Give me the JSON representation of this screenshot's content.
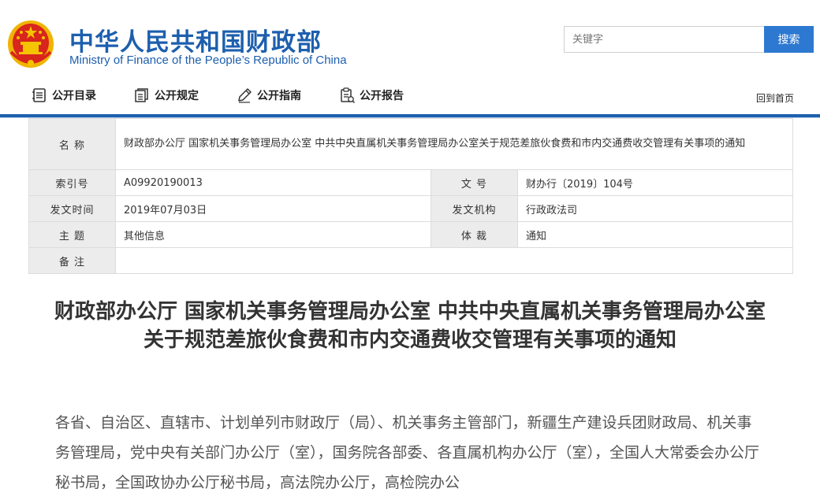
{
  "header": {
    "title_cn": "中华人民共和国财政部",
    "title_en": "Ministry of Finance of the People’s Republic of China",
    "search_placeholder": "关键字",
    "search_button": "搜索"
  },
  "nav": {
    "items": [
      {
        "label": "公开目录",
        "icon": "catalog-icon"
      },
      {
        "label": "公开规定",
        "icon": "documents-icon"
      },
      {
        "label": "公开指南",
        "icon": "pencil-icon"
      },
      {
        "label": "公开报告",
        "icon": "clipboard-icon"
      }
    ],
    "home": "回到首页"
  },
  "meta": {
    "name_label": "名 称",
    "name_value": "财政部办公厅 国家机关事务管理局办公室 中共中央直属机关事务管理局办公室关于规范差旅伙食费和市内交通费收交管理有关事项的通知",
    "index_label": "索引号",
    "index_value": "A09920190013",
    "docno_label": "文 号",
    "docno_value": "财办行〔2019〕104号",
    "date_label": "发文时间",
    "date_value": "2019年07月03日",
    "org_label": "发文机构",
    "org_value": "行政政法司",
    "topic_label": "主 题",
    "topic_value": "其他信息",
    "genre_label": "体 裁",
    "genre_value": "通知",
    "remark_label": "备 注",
    "remark_value": ""
  },
  "article": {
    "title": "财政部办公厅 国家机关事务管理局办公室 中共中央直属机关事务管理局办公室关于规范差旅伙食费和市内交通费收交管理有关事项的通知",
    "body": "各省、自治区、直辖市、计划单列市财政厅（局）、机关事务主管部门，新疆生产建设兵团财政局、机关事务管理局，党中央有关部门办公厅（室），国务院各部委、各直属机构办公厅（室），全国人大常委会办公厅秘书局，全国政协办公厅秘书局，高法院办公厅，高检院办公"
  },
  "colors": {
    "brand_blue": "#1d5fae",
    "button_blue": "#2d79d1",
    "emblem_red": "#d8251d",
    "emblem_gold": "#f5c400"
  }
}
